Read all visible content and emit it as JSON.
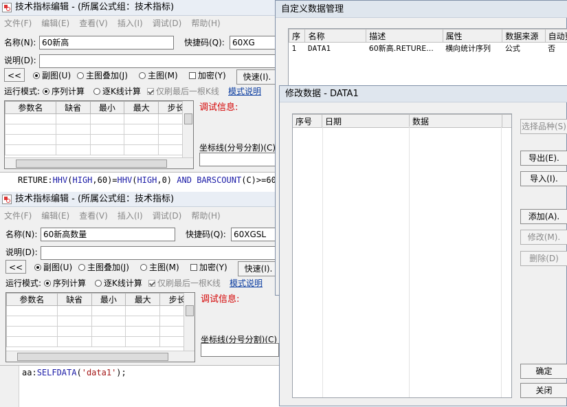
{
  "win1": {
    "title": "技术指标编辑 - (所属公式组：技术指标)",
    "menu": [
      "文件(F)",
      "编辑(E)",
      "查看(V)",
      "插入(I)",
      "调试(D)",
      "帮助(H)"
    ],
    "name_label": "名称(N):",
    "name_value": "60新高",
    "shortcut_label": "快捷码(Q):",
    "shortcut_value": "60XG",
    "desc_label": "说明(D):",
    "collapse_btn": "<<",
    "radio_sub": "副图(U)",
    "radio_main_overlay": "主图叠加(J)",
    "radio_main": "主图(M)",
    "chk_encrypt": "加密(Y)",
    "quick_btn": "快速(I).",
    "mode_label": "运行模式:",
    "mode_seq": "序列计算",
    "mode_line": "逐K线计算",
    "chk_last_only": "仅刷最后一根K线",
    "mode_help": "模式说明",
    "param_headers": [
      "参数名",
      "缺省",
      "最小",
      "最大",
      "步长"
    ],
    "debug_label": "调试信息:",
    "coord_label": "坐标线(分号分割)(C)",
    "code_tokens": [
      {
        "t": "RETURE:",
        "c": ""
      },
      {
        "t": "HHV",
        "c": "kw"
      },
      {
        "t": "(",
        "c": ""
      },
      {
        "t": "HIGH",
        "c": "kw"
      },
      {
        "t": ",60)=",
        "c": ""
      },
      {
        "t": "HHV",
        "c": "kw"
      },
      {
        "t": "(",
        "c": ""
      },
      {
        "t": "HIGH",
        "c": "kw"
      },
      {
        "t": ",0) ",
        "c": ""
      },
      {
        "t": "AND",
        "c": "kw"
      },
      {
        "t": " ",
        "c": ""
      },
      {
        "t": "BARSCOUNT",
        "c": "kw"
      },
      {
        "t": "(C)>=60;",
        "c": ""
      }
    ]
  },
  "win2": {
    "title": "技术指标编辑 - (所属公式组：技术指标)",
    "menu": [
      "文件(F)",
      "编辑(E)",
      "查看(V)",
      "插入(I)",
      "调试(D)",
      "帮助(H)"
    ],
    "name_label": "名称(N):",
    "name_value": "60新高数量",
    "shortcut_label": "快捷码(Q):",
    "shortcut_value": "60XGSL",
    "desc_label": "说明(D):",
    "collapse_btn": "<<",
    "radio_sub": "副图(U)",
    "radio_main_overlay": "主图叠加(J)",
    "radio_main": "主图(M)",
    "chk_encrypt": "加密(Y)",
    "quick_btn": "快速(I).",
    "mode_label": "运行模式:",
    "mode_seq": "序列计算",
    "mode_line": "逐K线计算",
    "chk_last_only": "仅刷最后一根K线",
    "mode_help": "模式说明",
    "param_headers": [
      "参数名",
      "缺省",
      "最小",
      "最大",
      "步长"
    ],
    "debug_label": "调试信息:",
    "coord_label": "坐标线(分号分割)(C)",
    "code_tokens": [
      {
        "t": "aa:",
        "c": ""
      },
      {
        "t": "SELFDATA",
        "c": "kw"
      },
      {
        "t": "(",
        "c": ""
      },
      {
        "t": "'data1'",
        "c": "str"
      },
      {
        "t": ");",
        "c": ""
      }
    ]
  },
  "custom_data": {
    "title": "自定义数据管理",
    "headers": [
      "序",
      "名称",
      "描述",
      "属性",
      "数据来源",
      "自动更"
    ],
    "rows": [
      [
        "1",
        "DATA1",
        "60新高.RETURE...",
        "横向统计序列",
        "公式",
        "否"
      ]
    ]
  },
  "modify": {
    "title": "修改数据 - DATA1",
    "headers": [
      "序号",
      "日期",
      "数据"
    ],
    "buttons": {
      "select": "选择品种(S)",
      "export": "导出(E).",
      "import": "导入(I).",
      "add": "添加(A).",
      "edit": "修改(M).",
      "delete": "删除(D)",
      "ok": "确定",
      "close": "关闭"
    }
  }
}
